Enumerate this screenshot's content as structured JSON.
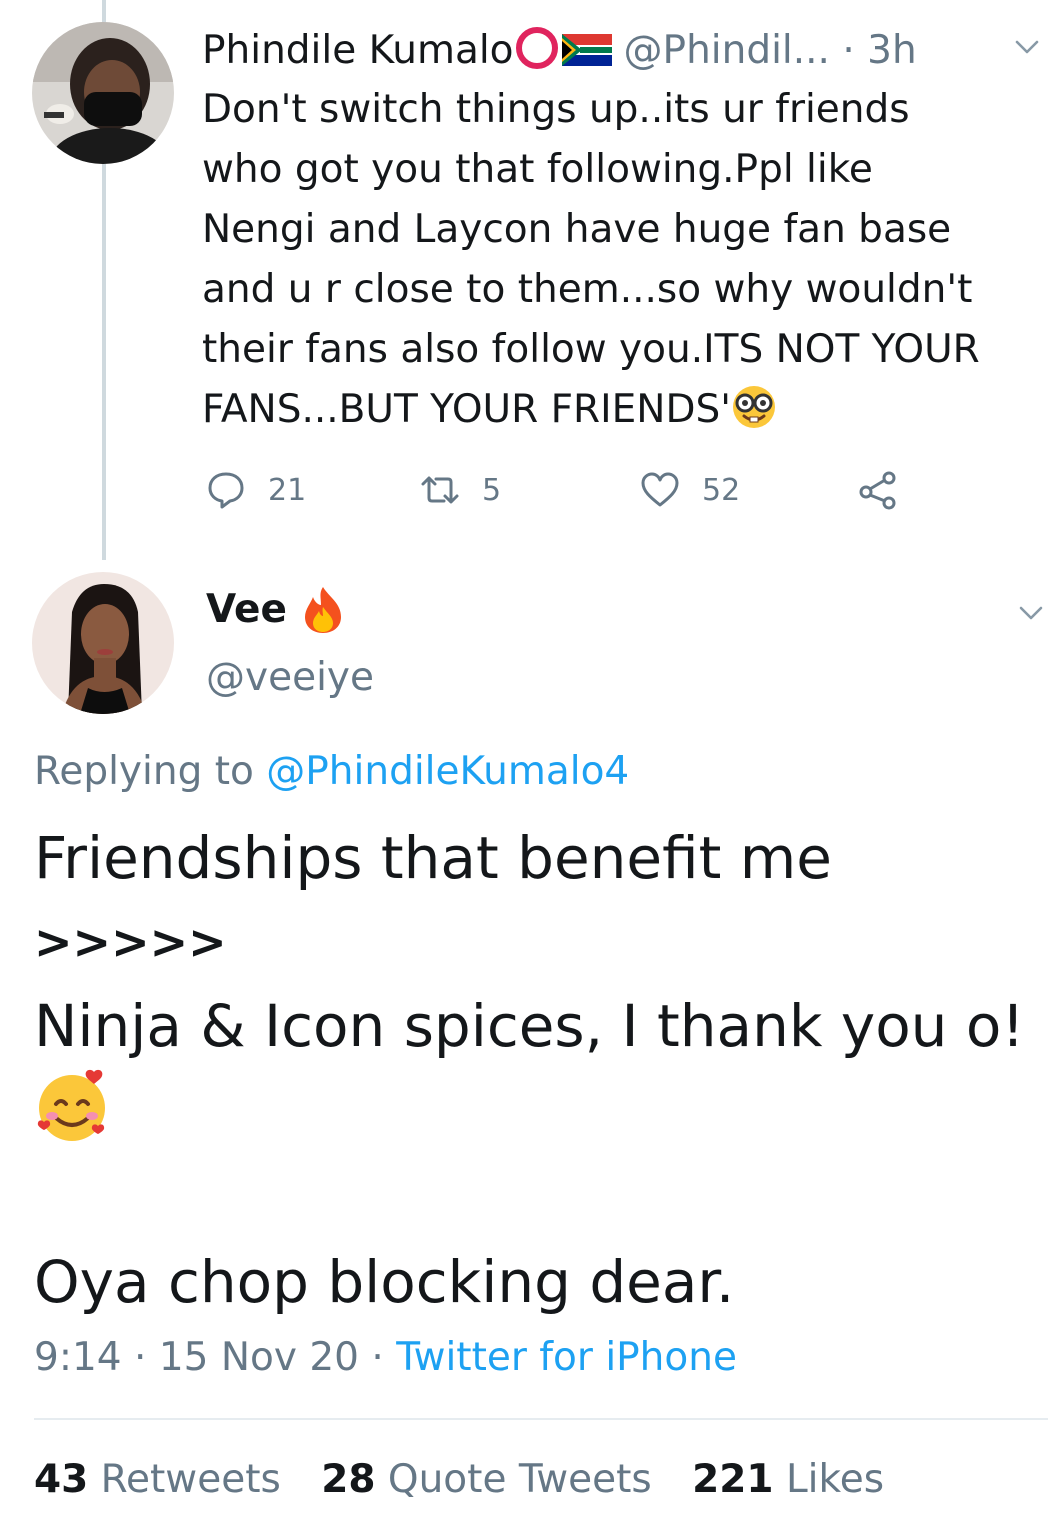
{
  "parent_tweet": {
    "author_name": "Phindile Kumalo",
    "handle": "@Phindil...",
    "time": "· 3h",
    "body_lines": [
      "Don't switch things up..its ur friends",
      "who got you that following.Ppl like",
      "Nengi and Laycon have huge fan base",
      "and u r close to them...so why wouldn't",
      "their fans also follow you.ITS NOT YOUR",
      "FANS...BUT YOUR FRIENDS'"
    ],
    "actions": {
      "replies": "21",
      "retweets": "5",
      "likes": "52"
    },
    "icons": {
      "reply": "reply-icon",
      "retweet": "retweet-icon",
      "like": "heart-icon",
      "share": "share-icon",
      "flag": "south-africa-flag-icon",
      "circle": "red-circle-icon",
      "emoji": "nerd-face-emoji"
    }
  },
  "main_tweet": {
    "author_name": "Vee",
    "name_emoji": "fire-emoji",
    "handle": "@veeiye",
    "replying_prefix": "Replying to ",
    "replying_to": "@PhindileKumalo4",
    "text_line1": "Friendships that benefit me",
    "text_line2": ">>>>>",
    "text_line3": "Ninja & Icon spices, I thank you o!",
    "text_emoji": "smiling-face-with-hearts-emoji",
    "text_line5": "Oya chop blocking dear.",
    "time": "9:14",
    "date": "15 Nov 20",
    "separator": "·",
    "source": "Twitter for iPhone",
    "stats": {
      "retweets_count": "43",
      "retweets_label": " Retweets",
      "quotes_count": "28",
      "quotes_label": " Quote Tweets",
      "likes_count": "221",
      "likes_label": " Likes"
    }
  },
  "colors": {
    "text": "#14171a",
    "secondary": "#657786",
    "link": "#1da1f2",
    "divider": "#e6ecf0",
    "thread_line": "#cfd9de",
    "ring": "#e0245e"
  }
}
